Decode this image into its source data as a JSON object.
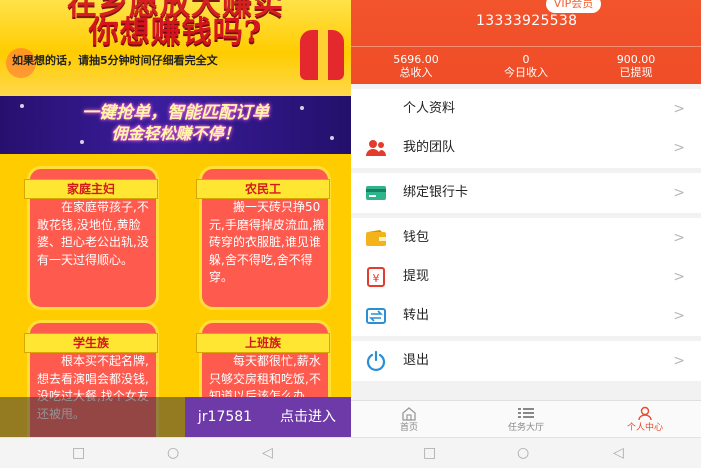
{
  "ad": {
    "headline_top": "在乡愿放大赚实",
    "headline": "你想赚钱吗?",
    "subline": "如果想的话，请抽5分钟时间仔细看完全文",
    "banner_line1": "一键抢单，智能匹配订单",
    "banner_line2": "佣金轻松赚不停！",
    "cards": [
      {
        "title": "家庭主妇",
        "text": "在家庭带孩子,不敢花钱,没地位,黄脸婆、担心老公出轨,没有一天过得顺心。"
      },
      {
        "title": "农民工",
        "text": "搬一天砖只挣50元,手磨得掉皮流血,搬砖穿的衣服脏,谁见谁躲,舍不得吃,舍不得穿。"
      },
      {
        "title": "学生族",
        "text": "根本买不起名牌,想去看演唱会都没钱,没吃过大餐,找个女友还被甩。"
      },
      {
        "title": "上班族",
        "text": "每天都很忙,薪水只够交房租和吃饭,不知道以后该怎么办。"
      }
    ],
    "promo_code": "jr17581",
    "promo_button": "点击进入"
  },
  "profile": {
    "vip_badge": "VIP会员",
    "phone": "13333925538",
    "stats": [
      {
        "value": "5696.00",
        "label": "总收入"
      },
      {
        "value": "0",
        "label": "今日收入"
      },
      {
        "value": "900.00",
        "label": "已提现"
      }
    ],
    "menu": [
      {
        "label": "个人资料",
        "icon": "none",
        "chevron": ">"
      },
      {
        "label": "我的团队",
        "icon": "team-icon",
        "chevron": ">"
      },
      {
        "label": "绑定银行卡",
        "icon": "bank-card-icon",
        "chevron": ">"
      },
      {
        "label": "钱包",
        "icon": "wallet-icon",
        "chevron": ">"
      },
      {
        "label": "提现",
        "icon": "withdraw-icon",
        "chevron": ">"
      },
      {
        "label": "转出",
        "icon": "transfer-icon",
        "chevron": ">"
      },
      {
        "label": "退出",
        "icon": "power-icon",
        "chevron": ">"
      }
    ],
    "tabs": [
      {
        "label": "首页",
        "icon": "home-icon"
      },
      {
        "label": "任务大厅",
        "icon": "list-icon"
      },
      {
        "label": "个人中心",
        "icon": "user-icon"
      }
    ],
    "colors": {
      "accent": "#ef4d27",
      "active_tab": "#e84a2e"
    }
  },
  "system_nav": {
    "left": [
      "□",
      "○",
      "◁"
    ],
    "right": [
      "□",
      "○",
      "◁"
    ]
  }
}
